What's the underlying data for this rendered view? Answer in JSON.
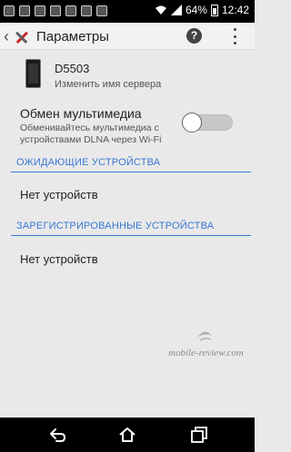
{
  "status_bar": {
    "battery": "64%",
    "time": "12:42",
    "icons": [
      "notification-icon",
      "notification-icon",
      "notification-icon",
      "notification-icon",
      "notification-icon",
      "notification-icon",
      "notification-icon",
      "wifi-icon",
      "signal-icon",
      "battery-icon"
    ]
  },
  "action_bar": {
    "title": "Параметры",
    "help_icon": "?"
  },
  "server": {
    "name": "D5503",
    "subtitle": "Изменить имя сервера"
  },
  "media_sharing": {
    "title": "Обмен мультимедиа",
    "description": "Обменивайтесь мультимедиа с устройствами DLNA через Wi-Fi",
    "enabled": false
  },
  "sections": [
    {
      "header": "ОЖИДАЮЩИЕ УСТРОЙСТВА",
      "empty_text": "Нет устройств"
    },
    {
      "header": "ЗАРЕГИСТРИРОВАННЫЕ УСТРОЙСТВА",
      "empty_text": "Нет устройств"
    }
  ],
  "watermark": "mobile-review.com",
  "colors": {
    "accent": "#3a77d5",
    "background": "#e9e9e9"
  },
  "nav_bar": {
    "icons": [
      "back-icon",
      "home-icon",
      "recent-apps-icon"
    ]
  }
}
